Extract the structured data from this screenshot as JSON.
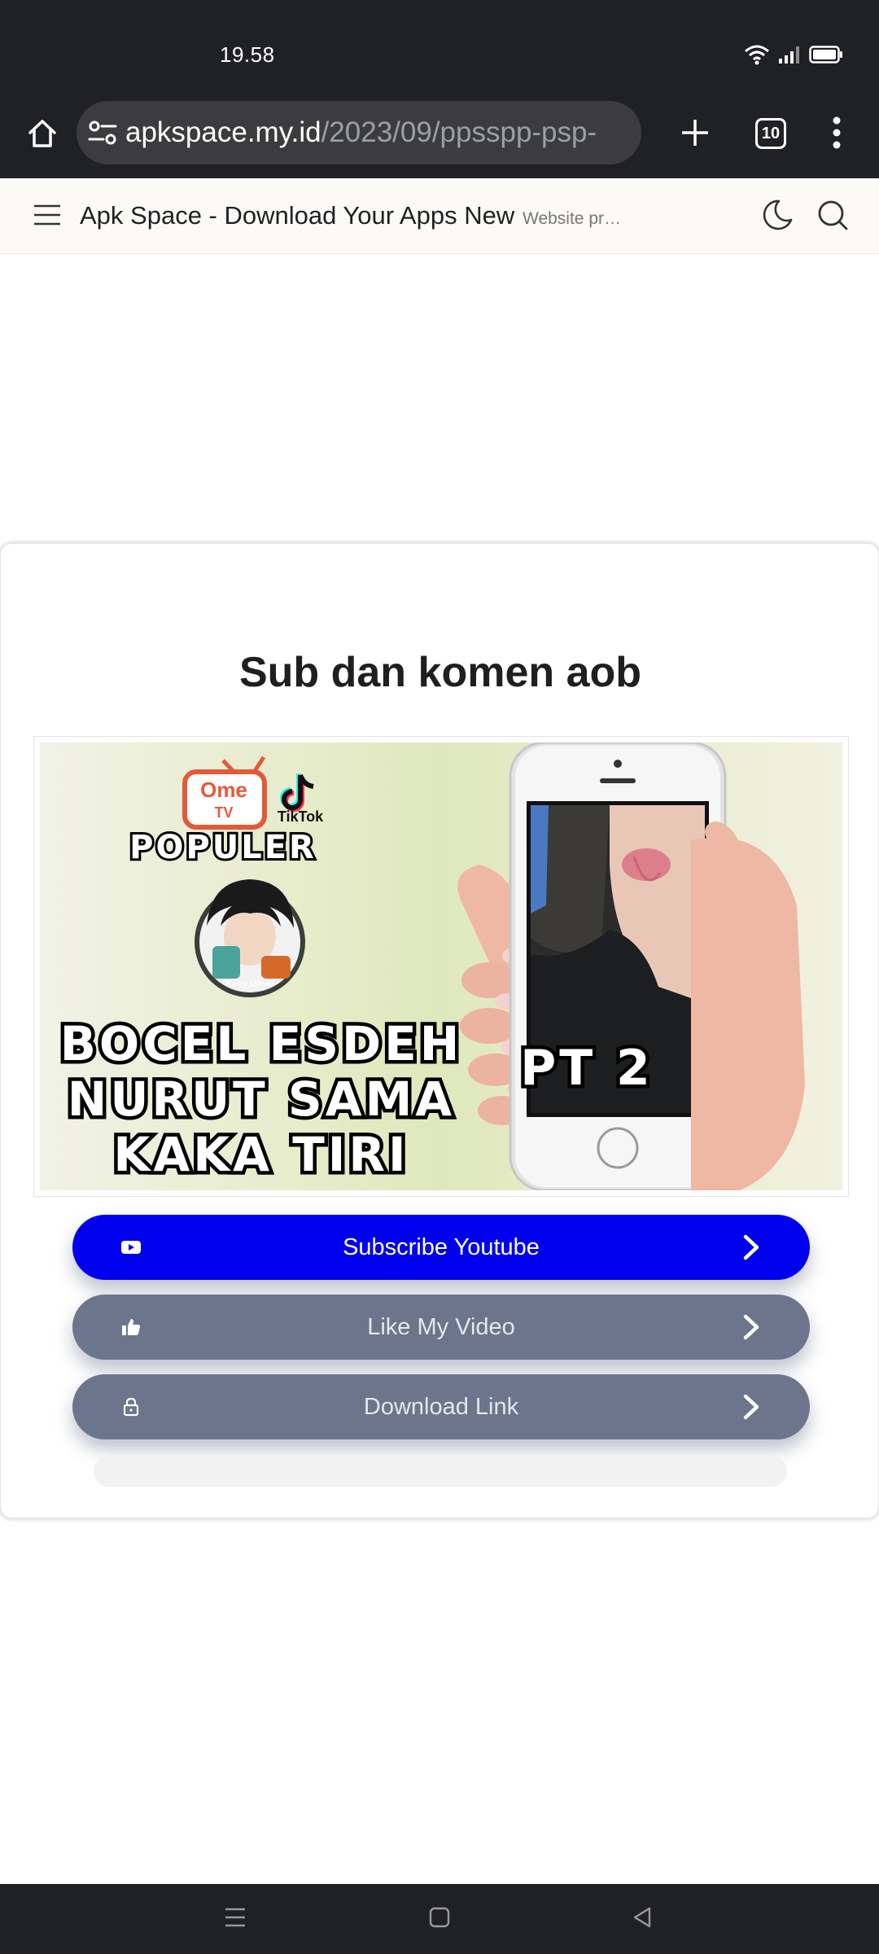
{
  "status_bar": {
    "time": "19.58"
  },
  "browser": {
    "url_host": "apkspace.my.id",
    "url_path": "/2023/09/ppsspp-psp-",
    "tab_count": "10"
  },
  "site": {
    "title": "Apk Space - Download Your Apps New",
    "tagline": "Website pr…"
  },
  "popup": {
    "title": "Sub dan komen aob",
    "thumbnail": {
      "brand_ome": "Ome",
      "brand_tv": "TV",
      "brand_tiktok": "TikTok",
      "label_populer": "POPULER",
      "headline_line1": "BOCEL ESDEH",
      "headline_line2": "NURUT SAMA",
      "headline_line3": "KAKA TIRI",
      "part_label": "PT 2"
    },
    "buttons": [
      {
        "label": "Subscribe Youtube",
        "icon": "youtube-icon",
        "color": "#0000ee"
      },
      {
        "label": "Like My Video",
        "icon": "thumbs-up-icon",
        "color": "#6c758c"
      },
      {
        "label": "Download Link",
        "icon": "lock-icon",
        "color": "#6c758c"
      }
    ]
  }
}
